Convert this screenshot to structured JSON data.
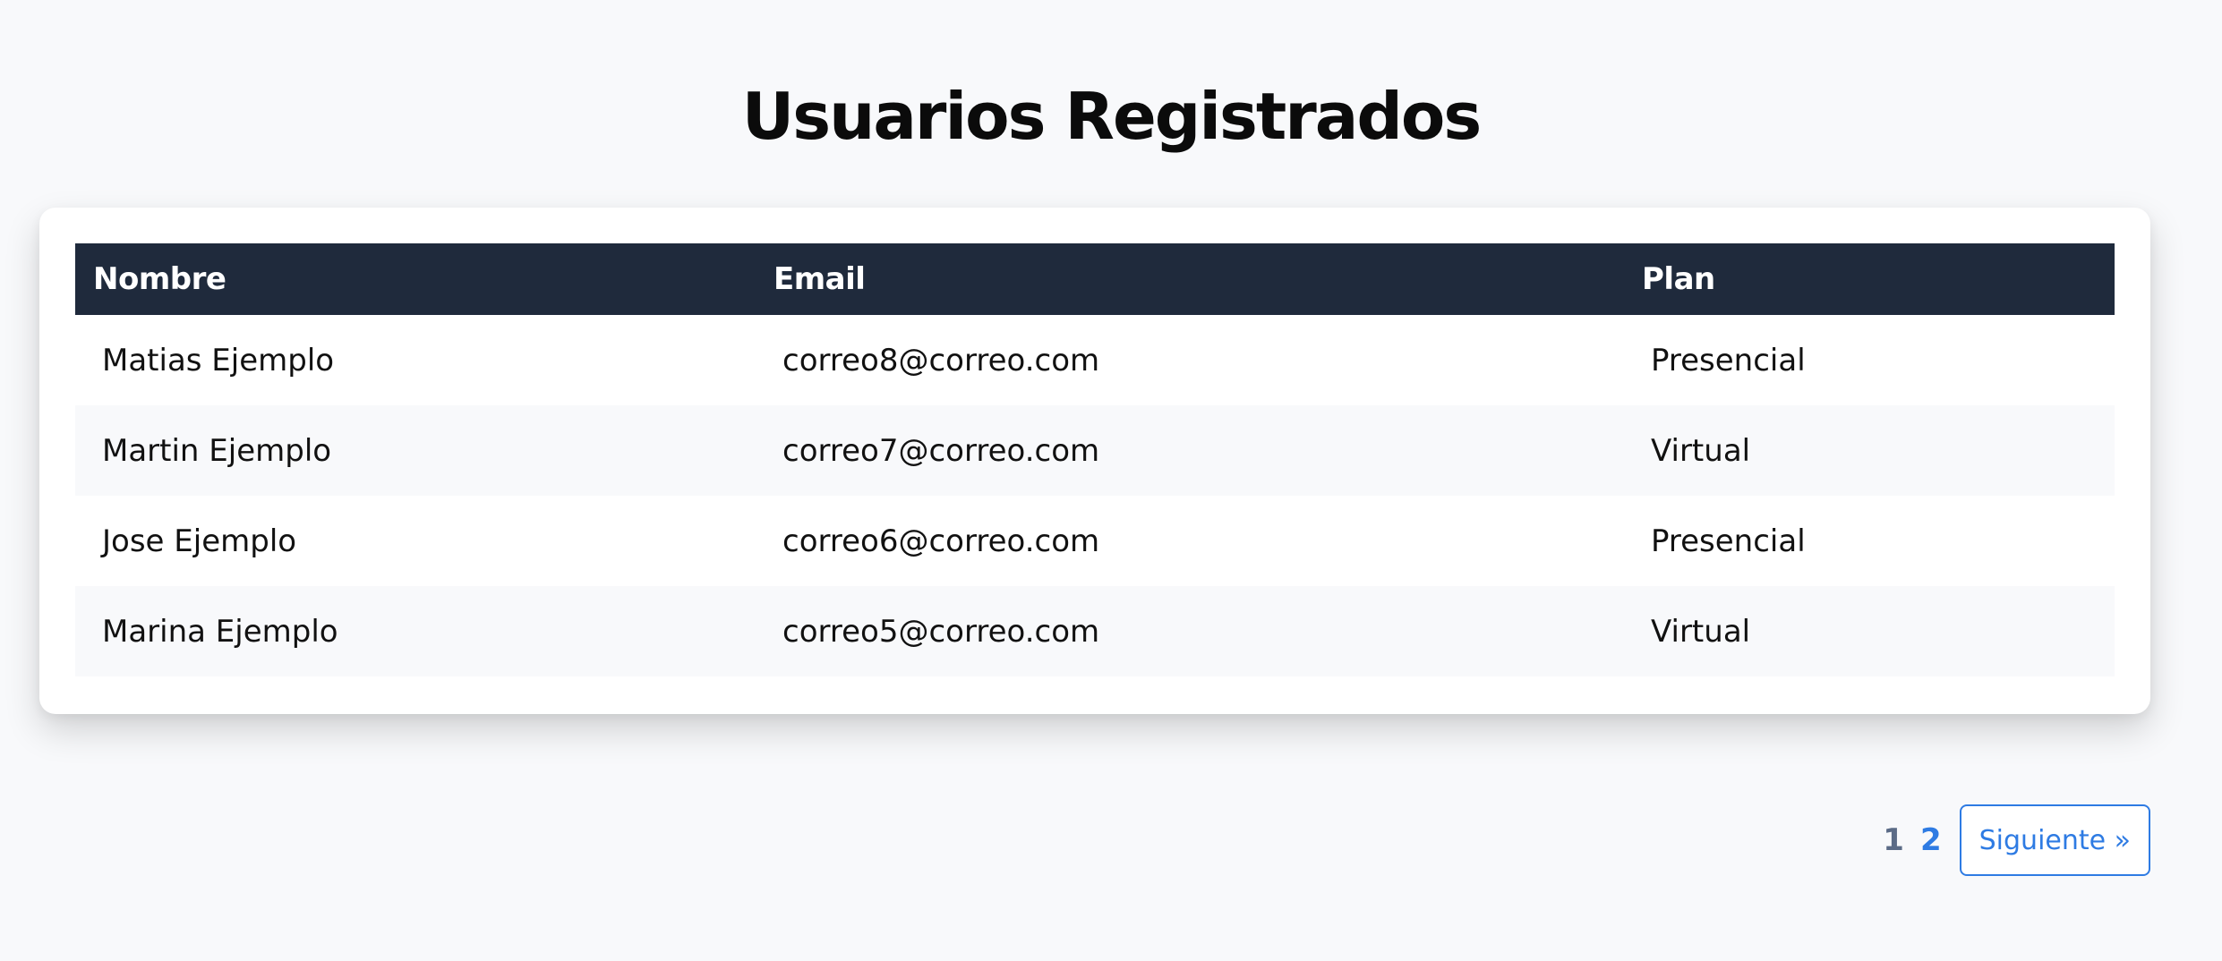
{
  "page": {
    "title": "Usuarios Registrados"
  },
  "table": {
    "headers": {
      "name": "Nombre",
      "email": "Email",
      "plan": "Plan"
    },
    "rows": [
      {
        "name": "Matias Ejemplo",
        "email": "correo8@correo.com",
        "plan": "Presencial"
      },
      {
        "name": "Martin Ejemplo",
        "email": "correo7@correo.com",
        "plan": "Virtual"
      },
      {
        "name": "Jose Ejemplo",
        "email": "correo6@correo.com",
        "plan": "Presencial"
      },
      {
        "name": "Marina Ejemplo",
        "email": "correo5@correo.com",
        "plan": "Virtual"
      }
    ]
  },
  "pagination": {
    "pages": [
      "1",
      "2"
    ],
    "current_page": "1",
    "next_label": "Siguiente »"
  },
  "colors": {
    "header_bg": "#1f2a3c",
    "accent": "#2e7be3",
    "page_bg": "#f8f9fb"
  }
}
